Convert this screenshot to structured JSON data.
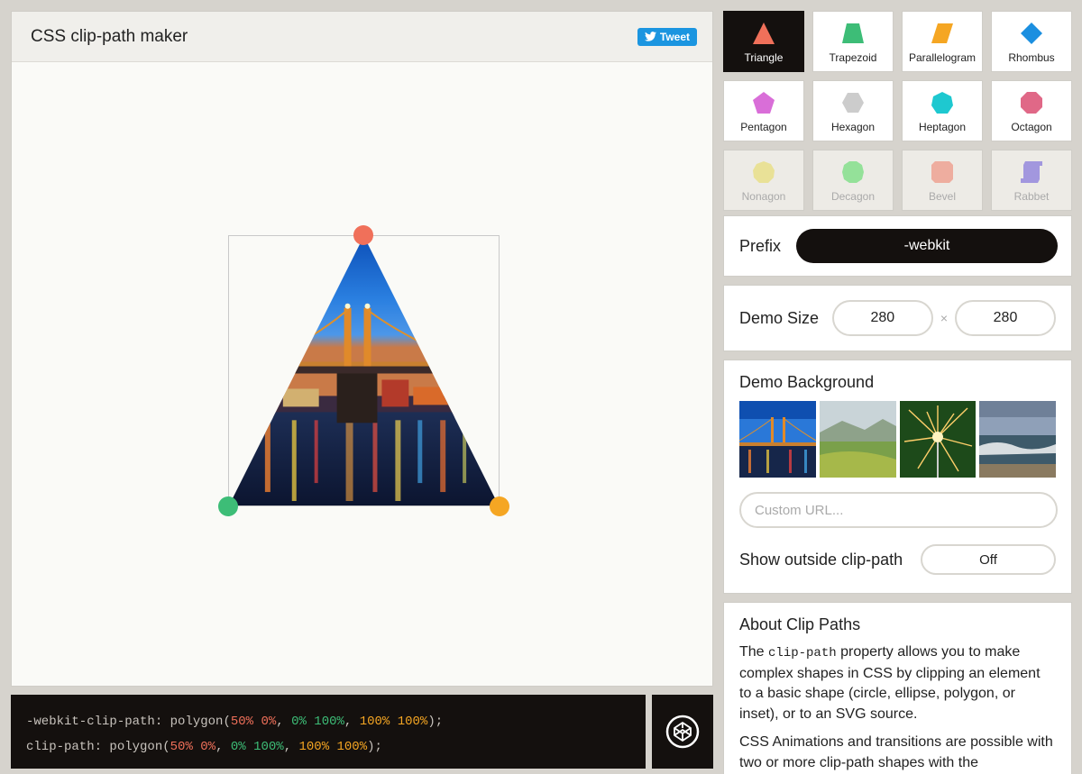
{
  "header": {
    "title": "CSS clip-path maker",
    "tweet_label": "Tweet"
  },
  "code": {
    "line1": {
      "prop": "-webkit-clip-path: ",
      "fn": "polygon(",
      "p1": "50% 0%",
      "sep1": ", ",
      "p2": "0% 100%",
      "sep2": ", ",
      "p3": "100% 100%",
      "end": ");"
    },
    "line2": {
      "prop": "clip-path: ",
      "fn": "polygon(",
      "p1": "50% 0%",
      "sep1": ", ",
      "p2": "0% 100%",
      "sep2": ", ",
      "p3": "100% 100%",
      "end": ");"
    }
  },
  "shapes": [
    {
      "label": "Triangle",
      "icon": "triangle-icon",
      "color": "#f0705a",
      "active": true
    },
    {
      "label": "Trapezoid",
      "icon": "trapezoid-icon",
      "color": "#3dbd77"
    },
    {
      "label": "Parallelogram",
      "icon": "parallelogram-icon",
      "color": "#f5a623"
    },
    {
      "label": "Rhombus",
      "icon": "rhombus-icon",
      "color": "#1b8fe0"
    },
    {
      "label": "Pentagon",
      "icon": "pentagon-icon",
      "color": "#d96ed8"
    },
    {
      "label": "Hexagon",
      "icon": "hexagon-icon",
      "color": "#cccccc"
    },
    {
      "label": "Heptagon",
      "icon": "heptagon-icon",
      "color": "#1ec8d0"
    },
    {
      "label": "Octagon",
      "icon": "octagon-icon",
      "color": "#e06887"
    },
    {
      "label": "Nonagon",
      "icon": "nonagon-icon",
      "color": "#e6d94a"
    },
    {
      "label": "Decagon",
      "icon": "decagon-icon",
      "color": "#3dd94f"
    },
    {
      "label": "Bevel",
      "icon": "bevel-icon",
      "color": "#f0705a"
    },
    {
      "label": "Rabbet",
      "icon": "rabbet-icon",
      "color": "#5a46d8"
    }
  ],
  "prefix": {
    "label": "Prefix",
    "value": "-webkit"
  },
  "demo_size": {
    "label": "Demo Size",
    "width": "280",
    "height": "280",
    "times": "×"
  },
  "demo_background": {
    "label": "Demo Background",
    "url_placeholder": "Custom URL...",
    "thumbs": [
      "bridge-night",
      "green-valley",
      "sparkler",
      "ocean-waves"
    ]
  },
  "outside": {
    "label": "Show outside clip-path",
    "value": "Off"
  },
  "about": {
    "title": "About Clip Paths",
    "p1_pre": "The ",
    "p1_code": "clip-path",
    "p1_post": " property allows you to make complex shapes in CSS by clipping an element to a basic shape (circle, ellipse, polygon, or inset), or to an SVG source.",
    "p2": "CSS Animations and transitions are possible with two or more clip-path shapes with the"
  }
}
